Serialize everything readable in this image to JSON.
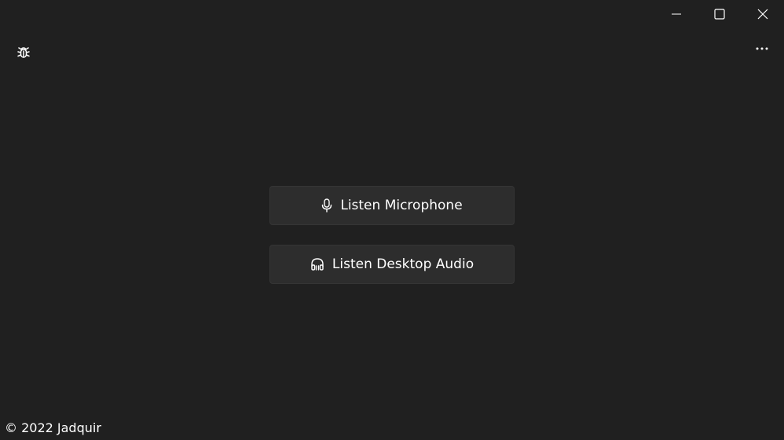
{
  "window": {
    "controls": {
      "minimize": "minimize-icon",
      "maximize": "maximize-icon",
      "close": "close-icon"
    }
  },
  "toolbar": {
    "debug_icon": "bug-icon",
    "more_icon": "more-icon"
  },
  "main": {
    "listen_microphone_label": "Listen Microphone",
    "listen_desktop_label": "Listen Desktop Audio"
  },
  "footer": {
    "copyright": "© 2022 Jadquir"
  },
  "colors": {
    "background": "#202020",
    "button_bg": "#2d2d2d",
    "text": "#ffffff"
  }
}
